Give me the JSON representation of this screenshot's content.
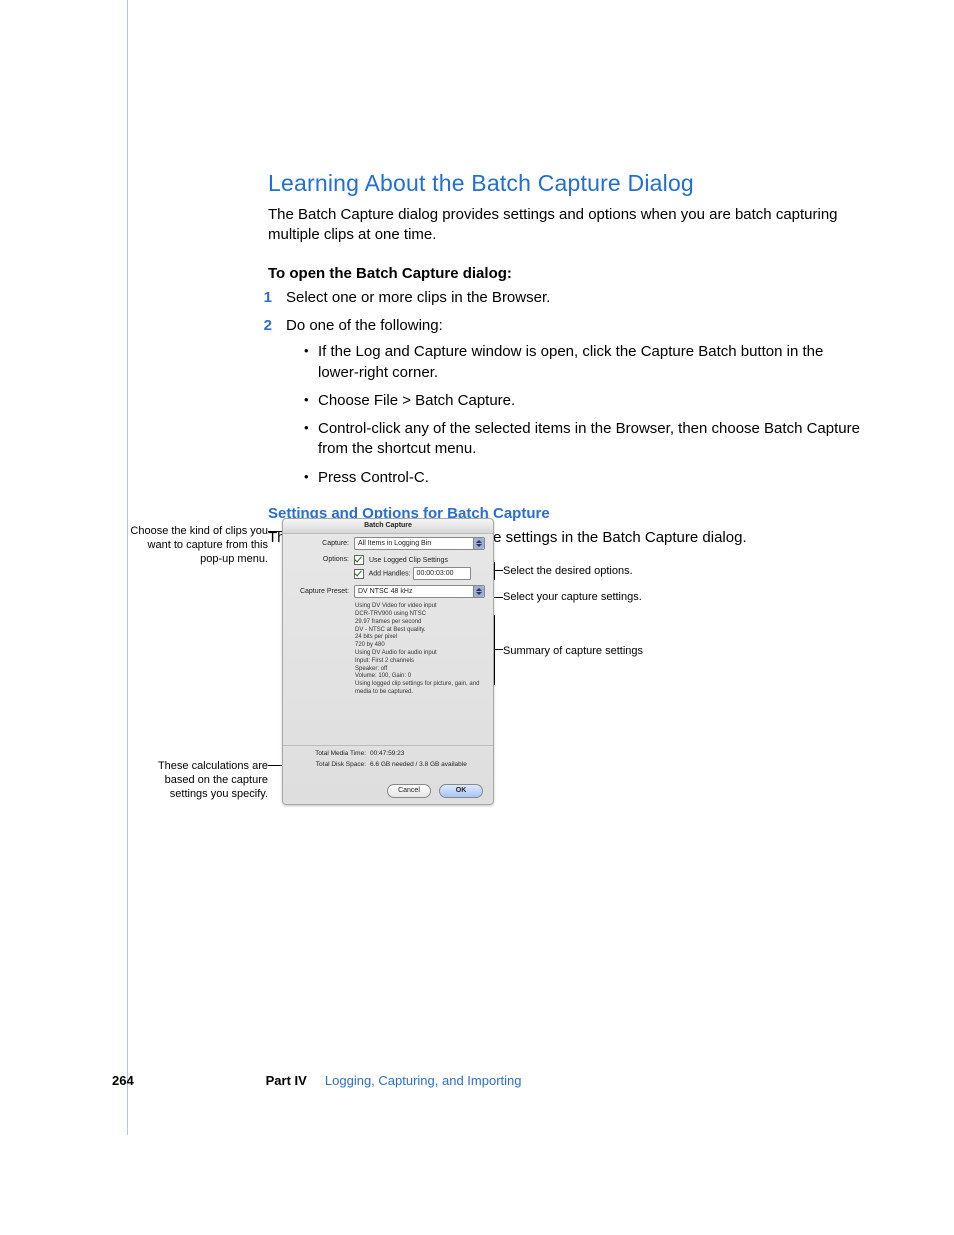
{
  "heading": "Learning About the Batch Capture Dialog",
  "intro": "The Batch Capture dialog provides settings and options when you are batch capturing multiple clips at one time.",
  "subhead": "To open the Batch Capture dialog:",
  "steps": {
    "s1": "Select one or more clips in the Browser.",
    "s2": "Do one of the following:"
  },
  "bullets": {
    "b1": "If the Log and Capture window is open, click the Capture Batch button in the lower-right corner.",
    "b2": "Choose File > Batch Capture.",
    "b3": "Control-click any of the selected items in the Browser, then choose Batch Capture from the shortcut menu.",
    "b4": "Press Control-C."
  },
  "subsection": "Settings and Options for Batch Capture",
  "following": "The following section describes the settings in the Batch Capture dialog.",
  "callouts": {
    "c_capture": "Choose the kind of clips you want to capture from this pop-up menu.",
    "c_options": "Select the desired options.",
    "c_preset": "Select your capture settings.",
    "c_summary": "Summary of capture settings",
    "c_calc": "These calculations are based on the capture settings you specify."
  },
  "dialog": {
    "title": "Batch Capture",
    "capture_label": "Capture:",
    "capture_value": "All Items in Logging Bin",
    "options_label": "Options:",
    "opt_use_logged": "Use Logged Clip Settings",
    "opt_add_handles": "Add Handles:",
    "handles_value": "00:00:03:00",
    "preset_label": "Capture Preset:",
    "preset_value": "DV NTSC 48 kHz",
    "details": {
      "l1": "Using DV Video for video input",
      "l2": "DCR-TRV900 using NTSC",
      "l3": "29.97 frames per second",
      "l4": "DV - NTSC at Best quality.",
      "l5": "24 bits per pixel",
      "l6": "720 by 480",
      "l7": "Using DV Audio for audio input",
      "l8": "Input: First 2 channels",
      "l9": "Speaker: off",
      "l10": "Volume: 100, Gain: 0",
      "l11": "Using logged clip settings for picture, gain, and media to be captured."
    },
    "tmt_label": "Total Media Time:",
    "tmt_value": "00:47:59:23",
    "tds_label": "Total Disk Space:",
    "tds_value": "6.6 GB needed / 3.8 GB available",
    "cancel": "Cancel",
    "ok": "OK"
  },
  "footer": {
    "page": "264",
    "part": "Part IV",
    "label": "Logging, Capturing, and Importing"
  }
}
